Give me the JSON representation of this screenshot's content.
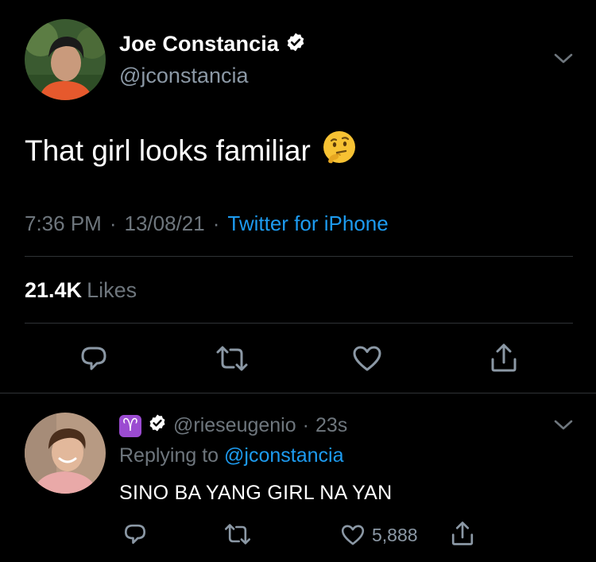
{
  "tweet": {
    "author": {
      "display_name": "Joe Constancia",
      "handle": "@jconstancia",
      "verified": true
    },
    "text": "That girl looks familiar",
    "emoji": "thinking-face",
    "time": "7:36 PM",
    "date": "13/08/21",
    "source": "Twitter for iPhone",
    "separator": "·",
    "likes_count": "21.4K",
    "likes_label": "Likes",
    "actions": [
      "reply",
      "retweet",
      "like",
      "share"
    ]
  },
  "reply": {
    "badge_symbol": "♈",
    "verified": true,
    "handle": "@rieseugenio",
    "separator": "·",
    "age": "23s",
    "replying_prefix": "Replying to",
    "replying_to": "@jconstancia",
    "text": "SINO BA YANG GIRL NA YAN",
    "like_count": "5,888"
  },
  "colors": {
    "background": "#000000",
    "primary_text": "#ffffff",
    "secondary_text": "#6e767d",
    "link": "#1d9bf0",
    "divider": "#2f3336",
    "icon": "#8b98a5"
  }
}
